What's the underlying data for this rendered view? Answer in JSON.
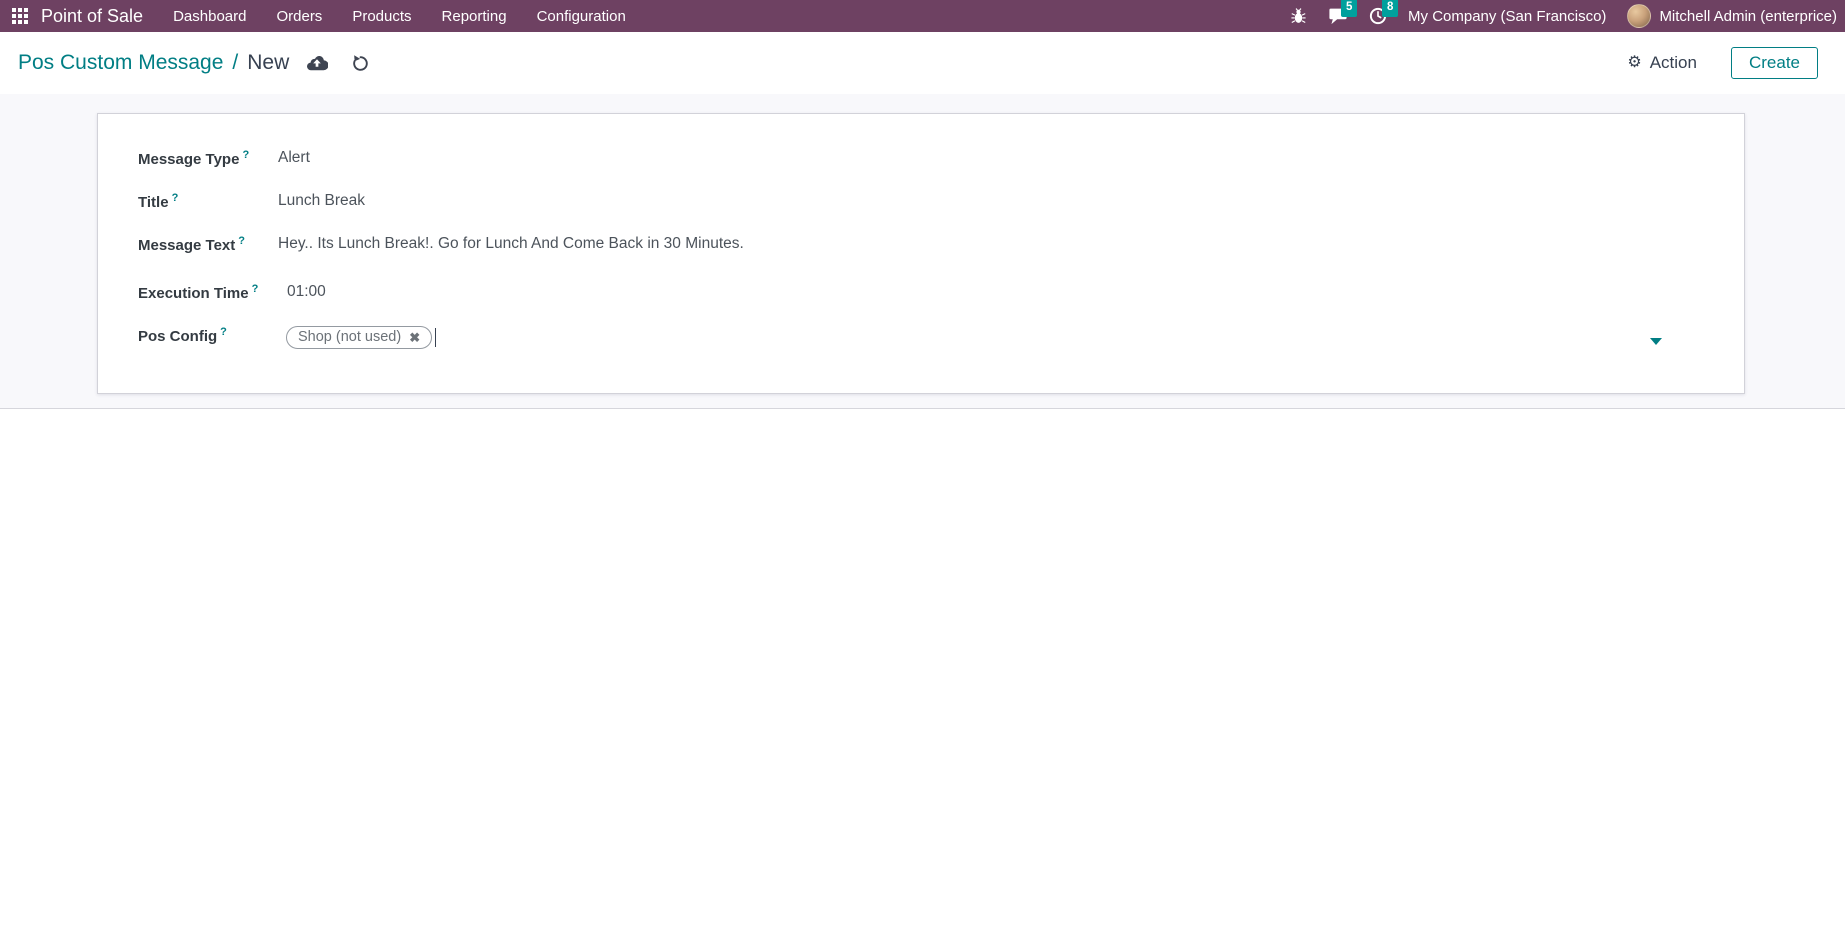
{
  "colors": {
    "navbar_bg": "#6e4162",
    "accent_teal": "#017e84",
    "badge_teal": "#00a09d",
    "content_bg": "#f8f8fb"
  },
  "navbar": {
    "app_name": "Point of Sale",
    "menu_items": [
      "Dashboard",
      "Orders",
      "Products",
      "Reporting",
      "Configuration"
    ],
    "chat_badge": "5",
    "activity_badge": "8",
    "company": "My Company (San Francisco)",
    "user": "Mitchell Admin (enterprice)"
  },
  "control_panel": {
    "breadcrumb_root": "Pos Custom Message",
    "breadcrumb_sep": "/",
    "breadcrumb_current": "New",
    "action_label": "Action",
    "create_label": "Create"
  },
  "icons": {
    "gear": "⚙",
    "tag_remove": "✖",
    "help": "?"
  },
  "form": {
    "fields": [
      {
        "label": "Message Type",
        "value": "Alert"
      },
      {
        "label": "Title",
        "value": "Lunch Break"
      },
      {
        "label": "Message Text",
        "value": "Hey.. Its Lunch Break!. Go for Lunch And Come Back in 30 Minutes."
      },
      {
        "label": "Execution Time",
        "value": "01:00"
      },
      {
        "label": "Pos Config",
        "tag_label": "Shop (not used)"
      }
    ]
  }
}
